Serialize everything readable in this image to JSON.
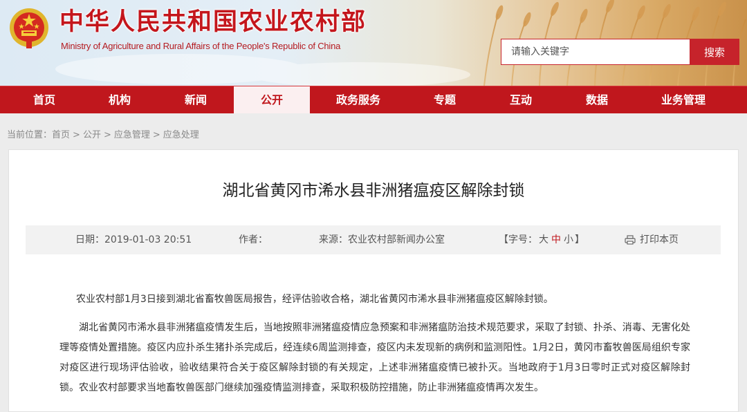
{
  "header": {
    "title_cn": "中华人民共和国农业农村部",
    "title_en": "Ministry of Agriculture and Rural Affairs of the People's Republic of China"
  },
  "search": {
    "placeholder": "请输入关键字",
    "button_label": "搜索"
  },
  "nav": {
    "items": [
      {
        "label": "首页"
      },
      {
        "label": "机构"
      },
      {
        "label": "新闻"
      },
      {
        "label": "公开"
      },
      {
        "label": "政务服务"
      },
      {
        "label": "专题"
      },
      {
        "label": "互动"
      },
      {
        "label": "数据"
      },
      {
        "label": "业务管理"
      }
    ]
  },
  "breadcrumb": {
    "prefix": "当前位置：",
    "items": [
      "首页",
      "公开",
      "应急管理",
      "应急处理"
    ],
    "separator": ">"
  },
  "article": {
    "title": "湖北省黄冈市浠水县非洲猪瘟疫区解除封锁",
    "meta": {
      "date_label": "日期：",
      "date_value": "2019-01-03 20:51",
      "author_label": "作者：",
      "author_value": "",
      "source_label": "来源：",
      "source_value": "农业农村部新闻办公室",
      "font_size_open": "【字号：",
      "font_size_large": "大",
      "font_size_medium": "中",
      "font_size_small": "小",
      "font_size_close": "】",
      "print_label": "打印本页"
    },
    "paragraphs": [
      "农业农村部1月3日接到湖北省畜牧兽医局报告，经评估验收合格，湖北省黄冈市浠水县非洲猪瘟疫区解除封锁。",
      "湖北省黄冈市浠水县非洲猪瘟疫情发生后，当地按照非洲猪瘟疫情应急预案和非洲猪瘟防治技术规范要求，采取了封锁、扑杀、消毒、无害化处理等疫情处置措施。疫区内应扑杀生猪扑杀完成后，经连续6周监测排查，疫区内未发现新的病例和监测阳性。1月2日，黄冈市畜牧兽医局组织专家对疫区进行现场评估验收，验收结果符合关于疫区解除封锁的有关规定，上述非洲猪瘟疫情已被扑灭。当地政府于1月3日零时正式对疫区解除封锁。农业农村部要求当地畜牧兽医部门继续加强疫情监测排查，采取积极防控措施，防止非洲猪瘟疫情再次发生。"
    ]
  },
  "colors": {
    "brand_red": "#c0171d",
    "nav_active_bg": "#fbeff0",
    "meta_bg": "#f2f2f2"
  },
  "icons": [
    "national-emblem-icon",
    "print-icon"
  ]
}
